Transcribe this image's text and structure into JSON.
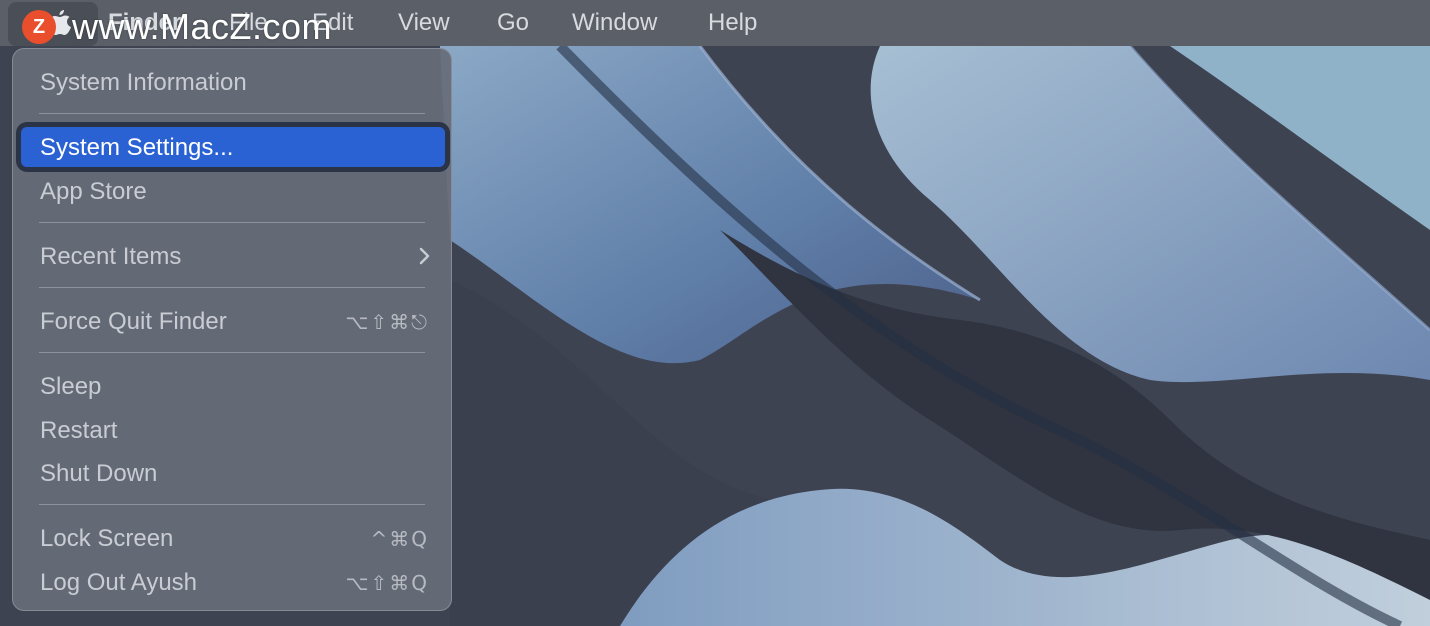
{
  "watermark": {
    "badge": "Z",
    "text": "www.MacZ.com"
  },
  "menubar": {
    "items": [
      "Finder",
      "File",
      "Edit",
      "View",
      "Go",
      "Window",
      "Help"
    ]
  },
  "apple_menu": {
    "items": [
      {
        "label": "System Information"
      },
      {
        "label": "System Settings..."
      },
      {
        "label": "App Store"
      },
      {
        "label": "Recent Items"
      },
      {
        "label": "Force Quit Finder",
        "shortcut": "⌥⇧⌘⎋"
      },
      {
        "label": "Sleep"
      },
      {
        "label": "Restart"
      },
      {
        "label": "Shut Down"
      },
      {
        "label": "Lock Screen",
        "shortcut": "^⌘Q"
      },
      {
        "label": "Log Out Ayush",
        "shortcut": "⌥⇧⌘Q"
      }
    ],
    "highlighted_item": "System Settings..."
  },
  "colors": {
    "menubar": "#5b6068",
    "menu_bg": "#676d78",
    "highlight": "#2a62d3",
    "wallpaper_dark": "#3d4250",
    "wallpaper_light": "#8ea7c1"
  },
  "icons": {
    "apple": "apple-icon",
    "submenu": "chevron-right-icon"
  }
}
